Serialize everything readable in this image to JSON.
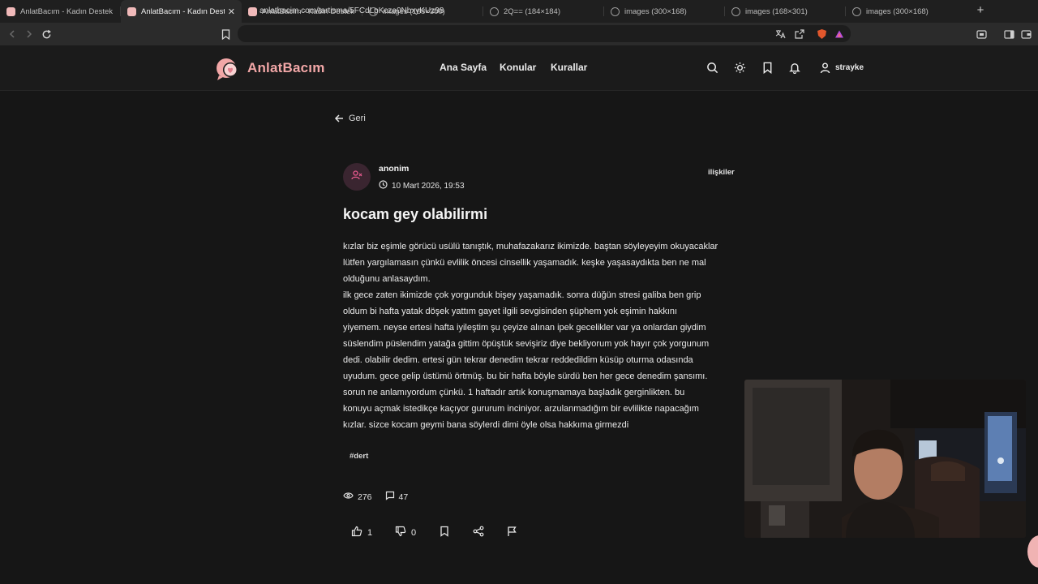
{
  "browser": {
    "tabs": [
      {
        "title": "AnlatBacım - Kadın Destek Plat",
        "favicon": "site-favicon",
        "active": false
      },
      {
        "title": "AnlatBacım - Kadın Destek",
        "favicon": "site-favicon",
        "active": true
      },
      {
        "title": "AnlatBacım - Kadın Destek Plat",
        "favicon": "site-favicon",
        "active": false
      },
      {
        "title": "images (168×300)",
        "favicon": "globe-icon",
        "active": false
      },
      {
        "title": "2Q== (184×184)",
        "favicon": "globe-icon",
        "active": false
      },
      {
        "title": "images (300×168)",
        "favicon": "globe-icon",
        "active": false
      },
      {
        "title": "images (168×301)",
        "favicon": "globe-icon",
        "active": false
      },
      {
        "title": "images (300×168)",
        "favicon": "globe-icon",
        "active": false
      }
    ],
    "close_glyph": "✕",
    "new_tab_glyph": "+",
    "url": "anlatbacim.com/tartisma/5FCdLpKcza0NbxyKUz98"
  },
  "site": {
    "brand": "AnlatBacım",
    "accent_color": "#f2a7a7",
    "nav": [
      "Ana Sayfa",
      "Konular",
      "Kurallar"
    ],
    "username": "strayke"
  },
  "post": {
    "back_label": "Geri",
    "author": "anonim",
    "date": "10 Mart 2026, 19:53",
    "category": "ilişkiler",
    "title": "kocam gey olabilirmi",
    "body_lines": [
      "kızlar biz eşimle görücü usülü tanıştık, muhafazakarız ikimizde. baştan söyleyeyim okuyacaklar",
      "lütfen yargılamasın çünkü evlilik öncesi cinsellik yaşamadık. keşke yaşasaydıkta ben ne mal",
      "olduğunu anlasaydım.",
      "ilk gece zaten ikimizde çok yorgunduk bişey yaşamadık. sonra düğün stresi  galiba ben grip",
      "oldum bi hafta yatak döşek yattım gayet ilgili sevgisinden şüphem yok eşimin hakkını",
      "yiyemem. neyse ertesi hafta iyileştim şu çeyize alınan ipek gecelikler var ya onlardan giydim",
      "süslendim püslendim yatağa gittim öpüştük sevişiriz diye bekliyorum yok hayır çok yorgunum",
      "dedi. olabilir dedim. ertesi gün tekrar denedim tekrar reddedildim küsüp oturma odasında",
      "uyudum. gece gelip üstümü örtmüş. bu bir hafta böyle sürdü ben her gece denedim şansımı.",
      "sorun ne anlamıyordum çünkü. 1 haftadır artık konuşmamaya başladık gerginlikten. bu",
      "konuyu açmak istedikçe kaçıyor gururum inciniyor. arzulanmadığım bir evlilikte napacağım",
      "kızlar. sizce kocam geymi bana söylerdi dimi öyle olsa hakkıma girmezdi"
    ],
    "tag": "#dert",
    "views": "276",
    "comments": "47",
    "likes": "1",
    "dislikes": "0"
  }
}
